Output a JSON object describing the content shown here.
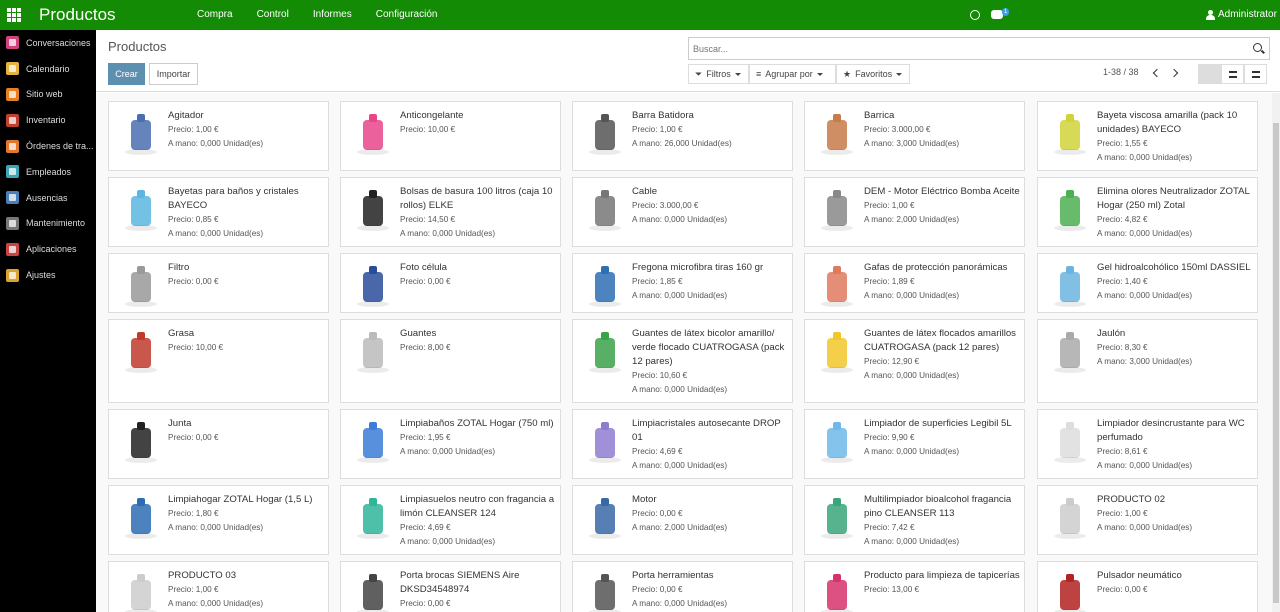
{
  "topbar": {
    "app_title": "Productos",
    "menu": [
      "Compra",
      "Control",
      "Informes",
      "Configuración"
    ],
    "chat_badge": "1",
    "user": "Administrator"
  },
  "sidebar": {
    "items": [
      {
        "label": "Conversaciones",
        "color": "#d2427f"
      },
      {
        "label": "Calendario",
        "color": "#e3b53f"
      },
      {
        "label": "Sitio web",
        "color": "#e67e22"
      },
      {
        "label": "Inventario",
        "color": "#c2402f"
      },
      {
        "label": "Órdenes de tra...",
        "color": "#e2782d"
      },
      {
        "label": "Empleados",
        "color": "#3da6b5"
      },
      {
        "label": "Ausencias",
        "color": "#4a7fb5"
      },
      {
        "label": "Mantenimiento",
        "color": "#777777"
      },
      {
        "label": "Aplicaciones",
        "color": "#c84545"
      },
      {
        "label": "Ajustes",
        "color": "#d9a52f"
      }
    ]
  },
  "control_panel": {
    "breadcrumb": "Productos",
    "create_label": "Crear",
    "import_label": "Importar",
    "search_placeholder": "Buscar...",
    "filters_label": "Filtros",
    "group_by_label": "Agrupar por",
    "favorites_label": "Favoritos",
    "pager": "1-38 / 38"
  },
  "products": [
    {
      "name": "Agitador",
      "price": "Precio: 1,00 €",
      "stock": "A mano: 0,000 Unidad(es)",
      "image": "stirrer-icon"
    },
    {
      "name": "Anticongelante",
      "price": "Precio: 10,00 €",
      "stock": "",
      "image": "antifreeze-icon"
    },
    {
      "name": "Barra Batidora",
      "price": "Precio: 1,00 €",
      "stock": "A mano: 26,000 Unidad(es)",
      "image": "blender-icon"
    },
    {
      "name": "Barrica",
      "price": "Precio: 3.000,00 €",
      "stock": "A mano: 3,000 Unidad(es)",
      "image": "barrel-icon"
    },
    {
      "name": "Bayeta viscosa amarilla (pack 10 unidades) BAYECO",
      "price": "Precio: 1,55 €",
      "stock": "A mano: 0,000 Unidad(es)",
      "image": "cloth-icon"
    },
    {
      "name": "Bayetas para baños y cristales BAYECO",
      "price": "Precio: 0,85 €",
      "stock": "A mano: 0,000 Unidad(es)",
      "image": "cloth-blue-icon"
    },
    {
      "name": "Bolsas de basura 100 litros (caja 10 rollos) ELKE",
      "price": "Precio: 14,50 €",
      "stock": "A mano: 0,000 Unidad(es)",
      "image": "trash-bags-icon"
    },
    {
      "name": "Cable",
      "price": "Precio: 3.000,00 €",
      "stock": "A mano: 0,000 Unidad(es)",
      "image": "cable-icon"
    },
    {
      "name": "DEM - Motor Eléctrico Bomba Aceite",
      "price": "Precio: 1,00 €",
      "stock": "A mano: 2,000 Unidad(es)",
      "image": "motor-icon"
    },
    {
      "name": "Elimina olores Neutralizador ZOTAL Hogar (250 ml) Zotal",
      "price": "Precio: 4,82 €",
      "stock": "A mano: 0,000 Unidad(es)",
      "image": "spray-icon"
    },
    {
      "name": "Filtro",
      "price": "Precio: 0,00 €",
      "stock": "",
      "image": "filter-icon"
    },
    {
      "name": "Foto célula",
      "price": "Precio: 0,00 €",
      "stock": "",
      "image": "photocell-icon"
    },
    {
      "name": "Fregona microfibra tiras 160 gr",
      "price": "Precio: 1,85 €",
      "stock": "A mano: 0,000 Unidad(es)",
      "image": "mop-icon"
    },
    {
      "name": "Gafas de protección panorámicas",
      "price": "Precio: 1,89 €",
      "stock": "A mano: 0,000 Unidad(es)",
      "image": "goggles-icon"
    },
    {
      "name": "Gel hidroalcohólico 150ml DASSIEL",
      "price": "Precio: 1,40 €",
      "stock": "A mano: 0,000 Unidad(es)",
      "image": "gel-icon"
    },
    {
      "name": "Grasa",
      "price": "Precio: 10,00 €",
      "stock": "",
      "image": "grease-icon"
    },
    {
      "name": "Guantes",
      "price": "Precio: 8,00 €",
      "stock": "",
      "image": "gloves-icon"
    },
    {
      "name": "Guantes de látex bicolor amarillo/ verde flocado CUATROGASA (pack 12 pares)",
      "price": "Precio: 10,60 €",
      "stock": "A mano: 0,000 Unidad(es)",
      "image": "latex-gloves-icon"
    },
    {
      "name": "Guantes de látex flocados amarillos CUATROGASA (pack 12 pares)",
      "price": "Precio: 12,90 €",
      "stock": "A mano: 0,000 Unidad(es)",
      "image": "yellow-gloves-icon"
    },
    {
      "name": "Jaulón",
      "price": "Precio: 8,30 €",
      "stock": "A mano: 3,000 Unidad(es)",
      "image": "cage-icon"
    },
    {
      "name": "Junta",
      "price": "Precio: 0,00 €",
      "stock": "",
      "image": "gasket-icon"
    },
    {
      "name": "Limpiabaños ZOTAL Hogar (750 ml)",
      "price": "Precio: 1,95 €",
      "stock": "A mano: 0,000 Unidad(es)",
      "image": "bath-cleaner-icon"
    },
    {
      "name": "Limpiacristales autosecante DROP 01",
      "price": "Precio: 4,69 €",
      "stock": "A mano: 0,000 Unidad(es)",
      "image": "glass-cleaner-icon"
    },
    {
      "name": "Limpiador de superficies Legibil 5L",
      "price": "Precio: 9,90 €",
      "stock": "A mano: 0,000 Unidad(es)",
      "image": "surface-cleaner-icon"
    },
    {
      "name": "Limpiador desincrustante para WC perfumado",
      "price": "Precio: 8,61 €",
      "stock": "A mano: 0,000 Unidad(es)",
      "image": "wc-cleaner-icon"
    },
    {
      "name": "Limpiahogar ZOTAL Hogar (1,5 L)",
      "price": "Precio: 1,80 €",
      "stock": "A mano: 0,000 Unidad(es)",
      "image": "home-cleaner-icon"
    },
    {
      "name": "Limpiasuelos neutro con fragancia a limón CLEANSER 124",
      "price": "Precio: 4,69 €",
      "stock": "A mano: 0,000 Unidad(es)",
      "image": "floor-cleaner-icon"
    },
    {
      "name": "Motor",
      "price": "Precio: 0,00 €",
      "stock": "A mano: 2,000 Unidad(es)",
      "image": "motor-blue-icon"
    },
    {
      "name": "Multilimpiador bioalcohol fragancia pino CLEANSER 113",
      "price": "Precio: 7,42 €",
      "stock": "A mano: 0,000 Unidad(es)",
      "image": "multi-cleaner-icon"
    },
    {
      "name": "PRODUCTO 02",
      "price": "Precio: 1,00 €",
      "stock": "A mano: 0,000 Unidad(es)",
      "image": "camera-placeholder-icon"
    },
    {
      "name": "PRODUCTO 03",
      "price": "Precio: 1,00 €",
      "stock": "A mano: 0,000 Unidad(es)",
      "image": "camera-placeholder-icon"
    },
    {
      "name": "Porta brocas SIEMENS Aire DKSD34548974",
      "price": "Precio: 0,00 €",
      "stock": "",
      "image": "drill-chuck-icon"
    },
    {
      "name": "Porta herramientas",
      "price": "Precio: 0,00 €",
      "stock": "A mano: 0,000 Unidad(es)",
      "image": "tool-holder-icon"
    },
    {
      "name": "Producto para limpieza de tapicerías",
      "price": "Precio: 13,00 €",
      "stock": "",
      "image": "upholstery-spray-icon"
    },
    {
      "name": "Pulsador neumático",
      "price": "Precio: 0,00 €",
      "stock": "",
      "image": "pneumatic-button-icon"
    }
  ]
}
